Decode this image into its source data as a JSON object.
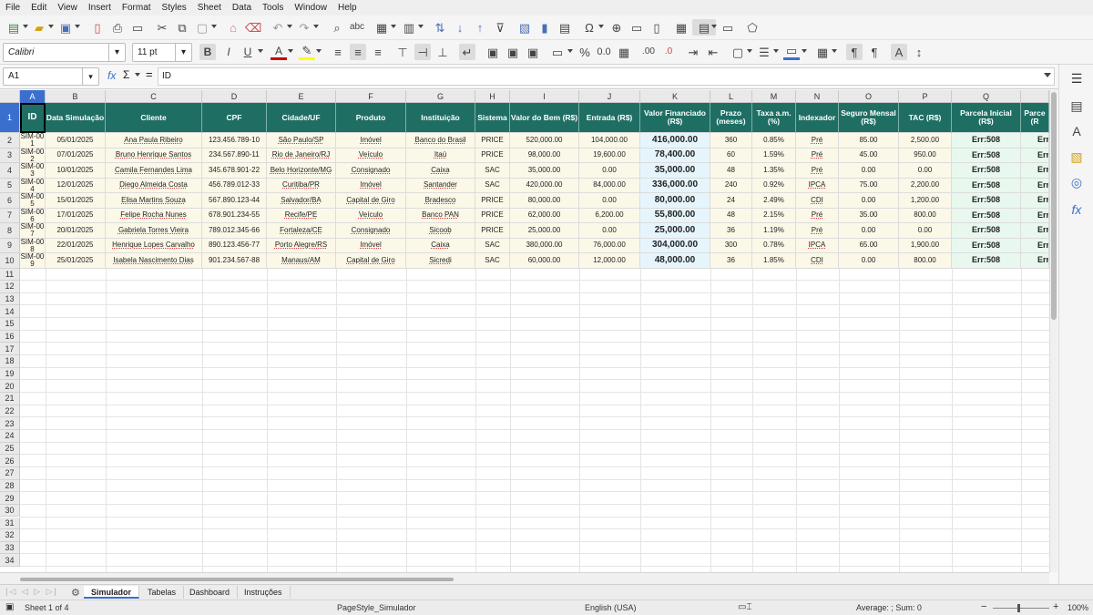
{
  "menu": [
    "File",
    "Edit",
    "View",
    "Insert",
    "Format",
    "Styles",
    "Sheet",
    "Data",
    "Tools",
    "Window",
    "Help"
  ],
  "toolbar2": {
    "font_name": "Calibri",
    "font_size": "11 pt"
  },
  "formula_bar": {
    "name_box": "A1",
    "content": "ID"
  },
  "columns": [
    "A",
    "B",
    "C",
    "D",
    "E",
    "F",
    "G",
    "H",
    "I",
    "J",
    "K",
    "L",
    "M",
    "N",
    "O",
    "P",
    "Q"
  ],
  "headers": [
    "ID",
    "Data Simulação",
    "Cliente",
    "CPF",
    "Cidade/UF",
    "Produto",
    "Instituição",
    "Sistema",
    "Valor do Bem (R$)",
    "Entrada (R$)",
    "Valor Financiado (R$)",
    "Prazo (meses)",
    "Taxa a.m. (%)",
    "Indexador",
    "Seguro Mensal (R$)",
    "TAC (R$)",
    "Parcela Inicial (R$)",
    "Parce (R"
  ],
  "rows": [
    {
      "id": "SIM-001",
      "data": "05/01/2025",
      "cliente": "Ana Paula Ribeiro",
      "cpf": "123.456.789-10",
      "cidade": "São Paulo/SP",
      "produto": "Imóvel",
      "inst": "Banco do Brasil",
      "sistema": "PRICE",
      "valor_bem": "520,000.00",
      "entrada": "104,000.00",
      "financiado": "416,000.00",
      "prazo": "360",
      "taxa": "0.85%",
      "index": "Pré",
      "seguro": "85.00",
      "tac": "2,500.00",
      "parcela": "Err:508",
      "parce2": "Err"
    },
    {
      "id": "SIM-002",
      "data": "07/01/2025",
      "cliente": "Bruno Henrique Santos",
      "cpf": "234.567.890-11",
      "cidade": "Rio de Janeiro/RJ",
      "produto": "Veículo",
      "inst": "Itaú",
      "sistema": "PRICE",
      "valor_bem": "98,000.00",
      "entrada": "19,600.00",
      "financiado": "78,400.00",
      "prazo": "60",
      "taxa": "1.59%",
      "index": "Pré",
      "seguro": "45.00",
      "tac": "950.00",
      "parcela": "Err:508",
      "parce2": "Err"
    },
    {
      "id": "SIM-003",
      "data": "10/01/2025",
      "cliente": "Camila Fernandes Lima",
      "cpf": "345.678.901-22",
      "cidade": "Belo Horizonte/MG",
      "produto": "Consignado",
      "inst": "Caixa",
      "sistema": "SAC",
      "valor_bem": "35,000.00",
      "entrada": "0.00",
      "financiado": "35,000.00",
      "prazo": "48",
      "taxa": "1.35%",
      "index": "Pré",
      "seguro": "0.00",
      "tac": "0.00",
      "parcela": "Err:508",
      "parce2": "Err"
    },
    {
      "id": "SIM-004",
      "data": "12/01/2025",
      "cliente": "Diego Almeida Costa",
      "cpf": "456.789.012-33",
      "cidade": "Curitiba/PR",
      "produto": "Imóvel",
      "inst": "Santander",
      "sistema": "SAC",
      "valor_bem": "420,000.00",
      "entrada": "84,000.00",
      "financiado": "336,000.00",
      "prazo": "240",
      "taxa": "0.92%",
      "index": "IPCA",
      "seguro": "75.00",
      "tac": "2,200.00",
      "parcela": "Err:508",
      "parce2": "Err"
    },
    {
      "id": "SIM-005",
      "data": "15/01/2025",
      "cliente": "Elisa Martins Souza",
      "cpf": "567.890.123-44",
      "cidade": "Salvador/BA",
      "produto": "Capital de Giro",
      "inst": "Bradesco",
      "sistema": "PRICE",
      "valor_bem": "80,000.00",
      "entrada": "0.00",
      "financiado": "80,000.00",
      "prazo": "24",
      "taxa": "2.49%",
      "index": "CDI",
      "seguro": "0.00",
      "tac": "1,200.00",
      "parcela": "Err:508",
      "parce2": "Err"
    },
    {
      "id": "SIM-006",
      "data": "17/01/2025",
      "cliente": "Felipe Rocha Nunes",
      "cpf": "678.901.234-55",
      "cidade": "Recife/PE",
      "produto": "Veículo",
      "inst": "Banco PAN",
      "sistema": "PRICE",
      "valor_bem": "62,000.00",
      "entrada": "6,200.00",
      "financiado": "55,800.00",
      "prazo": "48",
      "taxa": "2.15%",
      "index": "Pré",
      "seguro": "35.00",
      "tac": "800.00",
      "parcela": "Err:508",
      "parce2": "Err"
    },
    {
      "id": "SIM-007",
      "data": "20/01/2025",
      "cliente": "Gabriela Torres Vieira",
      "cpf": "789.012.345-66",
      "cidade": "Fortaleza/CE",
      "produto": "Consignado",
      "inst": "Sicoob",
      "sistema": "PRICE",
      "valor_bem": "25,000.00",
      "entrada": "0.00",
      "financiado": "25,000.00",
      "prazo": "36",
      "taxa": "1.19%",
      "index": "Pré",
      "seguro": "0.00",
      "tac": "0.00",
      "parcela": "Err:508",
      "parce2": "Err"
    },
    {
      "id": "SIM-008",
      "data": "22/01/2025",
      "cliente": "Henrique Lopes Carvalho",
      "cpf": "890.123.456-77",
      "cidade": "Porto Alegre/RS",
      "produto": "Imóvel",
      "inst": "Caixa",
      "sistema": "SAC",
      "valor_bem": "380,000.00",
      "entrada": "76,000.00",
      "financiado": "304,000.00",
      "prazo": "300",
      "taxa": "0.78%",
      "index": "IPCA",
      "seguro": "65.00",
      "tac": "1,900.00",
      "parcela": "Err:508",
      "parce2": "Err"
    },
    {
      "id": "SIM-009",
      "data": "25/01/2025",
      "cliente": "Isabela Nascimento Dias",
      "cpf": "901.234.567-88",
      "cidade": "Manaus/AM",
      "produto": "Capital de Giro",
      "inst": "Sicredi",
      "sistema": "SAC",
      "valor_bem": "60,000.00",
      "entrada": "12,000.00",
      "financiado": "48,000.00",
      "prazo": "36",
      "taxa": "1.85%",
      "index": "CDI",
      "seguro": "0.00",
      "tac": "800.00",
      "parcela": "Err:508",
      "parce2": "Err"
    }
  ],
  "sheet_tabs": [
    "Simulador",
    "Tabelas",
    "Dashboard",
    "Instruções"
  ],
  "status": {
    "sheet": "Sheet 1 of 4",
    "page_style": "PageStyle_Simulador",
    "language": "English (USA)",
    "summary": "Average: ; Sum: 0",
    "zoom": "100%"
  }
}
